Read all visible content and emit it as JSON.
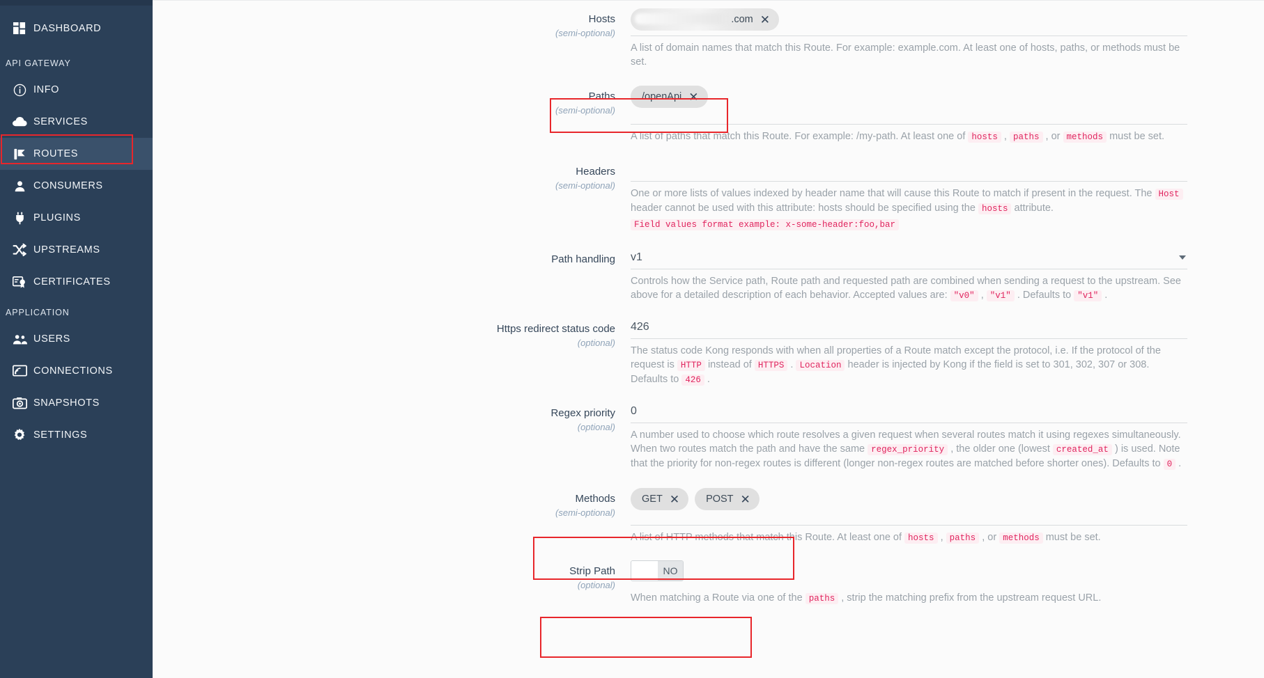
{
  "sidebar": {
    "dashboard": {
      "label": "DASHBOARD",
      "icon": "dashboard-grid-icon"
    },
    "sections": [
      {
        "title": "API GATEWAY",
        "items": [
          {
            "label": "INFO",
            "icon": "info-circle-icon",
            "active": false
          },
          {
            "label": "SERVICES",
            "icon": "cloud-icon",
            "active": false
          },
          {
            "label": "ROUTES",
            "icon": "route-fork-icon",
            "active": true
          },
          {
            "label": "CONSUMERS",
            "icon": "person-icon",
            "active": false
          },
          {
            "label": "PLUGINS",
            "icon": "plug-icon",
            "active": false
          },
          {
            "label": "UPSTREAMS",
            "icon": "shuffle-arrows-icon",
            "active": false
          },
          {
            "label": "CERTIFICATES",
            "icon": "certificate-badge-icon",
            "active": false
          }
        ]
      },
      {
        "title": "APPLICATION",
        "items": [
          {
            "label": "USERS",
            "icon": "people-icon",
            "active": false
          },
          {
            "label": "CONNECTIONS",
            "icon": "connection-screen-icon",
            "active": false
          },
          {
            "label": "SNAPSHOTS",
            "icon": "camera-icon",
            "active": false
          },
          {
            "label": "SETTINGS",
            "icon": "gear-icon",
            "active": false
          }
        ]
      }
    ]
  },
  "highlight_color": "#e8262b",
  "form": {
    "hosts": {
      "label": "Hosts",
      "optionality": "(semi-optional)",
      "chips": [
        {
          "value": ".com",
          "redacted": true,
          "remove_icon": "close-x-icon"
        }
      ],
      "desc_parts": [
        {
          "t": "A list of domain names that match this Route. For example: example.com. At least one of hosts, paths, or methods must be set."
        }
      ]
    },
    "paths": {
      "label": "Paths",
      "optionality": "(semi-optional)",
      "chips": [
        {
          "value": "/openApi",
          "redacted": false,
          "remove_icon": "close-x-icon"
        }
      ],
      "desc_lead": "A list of paths that match this Route. For example: /my-path. At least one of ",
      "desc_code1": "hosts",
      "desc_sep1": " , ",
      "desc_code2": "paths",
      "desc_sep2": " , or ",
      "desc_code3": "methods",
      "desc_tail": " must be set."
    },
    "headers": {
      "label": "Headers",
      "optionality": "(semi-optional)",
      "desc_lead": "One or more lists of values indexed by header name that will cause this Route to match if present in the request. The ",
      "desc_code1": "Host",
      "desc_mid": " header cannot be used with this attribute: hosts should be specified using the ",
      "desc_code2": "hosts",
      "desc_tail": " attribute.",
      "format_note": "Field values format example: x-some-header:foo,bar"
    },
    "path_handling": {
      "label": "Path handling",
      "optionality": "",
      "value": "v1",
      "caret_icon": "chevron-down-icon",
      "desc_lead": "Controls how the Service path, Route path and requested path are combined when sending a request to the upstream. See above for a detailed description of each behavior. Accepted values are: ",
      "desc_code1": "\"v0\"",
      "desc_sep1": " , ",
      "desc_code2": "\"v1\"",
      "desc_mid": " . Defaults to ",
      "desc_code3": "\"v1\"",
      "desc_tail": " ."
    },
    "https_redirect": {
      "label": "Https redirect status code",
      "optionality": "(optional)",
      "value": "426",
      "desc_lead": "The status code Kong responds with when all properties of a Route match except the protocol, i.e. If the protocol of the request is ",
      "desc_code1": "HTTP",
      "desc_mid1": " instead of ",
      "desc_code2": "HTTPS",
      "desc_mid2": " . ",
      "desc_code3": "Location",
      "desc_mid3": " header is injected by Kong if the field is set to 301, 302, 307 or 308. Defaults to ",
      "desc_code4": "426",
      "desc_tail": " ."
    },
    "regex_priority": {
      "label": "Regex priority",
      "optionality": "(optional)",
      "value": "0",
      "desc_lead": "A number used to choose which route resolves a given request when several routes match it using regexes simultaneously. When two routes match the path and have the same ",
      "desc_code1": "regex_priority",
      "desc_mid1": " , the older one (lowest ",
      "desc_code2": "created_at",
      "desc_mid2": " ) is used. Note that the priority for non-regex routes is different (longer non-regex routes are matched before shorter ones). Defaults to ",
      "desc_code3": "0",
      "desc_tail": " ."
    },
    "methods": {
      "label": "Methods",
      "optionality": "(semi-optional)",
      "chips": [
        {
          "value": "GET",
          "remove_icon": "close-x-icon"
        },
        {
          "value": "POST",
          "remove_icon": "close-x-icon"
        }
      ],
      "desc_lead": "A list of HTTP methods that match this Route. At least one of ",
      "desc_code1": "hosts",
      "desc_sep1": " , ",
      "desc_code2": "paths",
      "desc_sep2": " , or ",
      "desc_code3": "methods",
      "desc_tail": " must be set."
    },
    "strip_path": {
      "label": "Strip Path",
      "optionality": "(optional)",
      "toggle_state": "NO",
      "desc_lead": "When matching a Route via one of the ",
      "desc_code1": "paths",
      "desc_tail": " , strip the matching prefix from the upstream request URL."
    }
  }
}
